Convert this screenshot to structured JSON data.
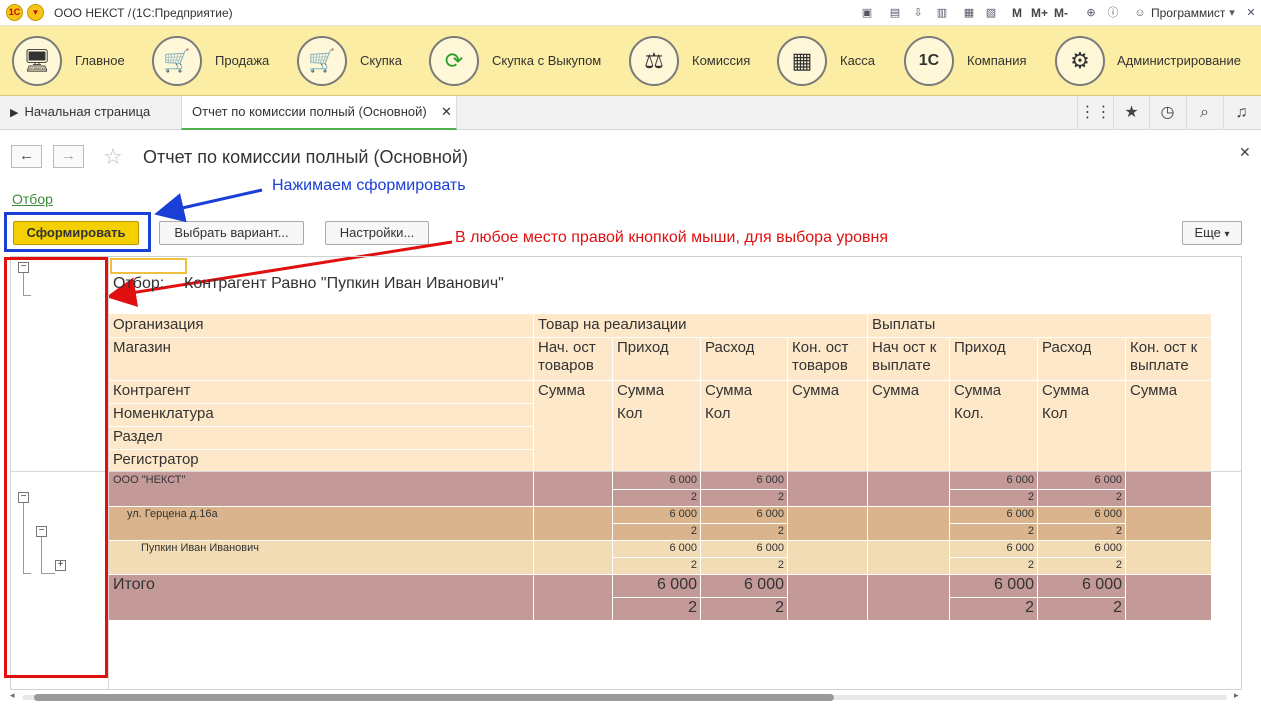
{
  "titlebar": {
    "app_name": "ООО НЕКСТ /",
    "platform": "(1С:Предприятие)",
    "m_buttons": [
      "M",
      "M+",
      "M-"
    ],
    "user": "Программист"
  },
  "sections": [
    {
      "label": "Главное",
      "icon": "computer-icon"
    },
    {
      "label": "Продажа",
      "icon": "cart-up-icon"
    },
    {
      "label": "Скупка",
      "icon": "cart-down-icon"
    },
    {
      "label": "Скупка с Выкупом",
      "icon": "refresh-icon"
    },
    {
      "label": "Комиссия",
      "icon": "scales-icon"
    },
    {
      "label": "Касса",
      "icon": "cash-register-icon"
    },
    {
      "label": "Компания",
      "icon": "1c-logo-icon"
    },
    {
      "label": "Администрирование",
      "icon": "gears-icon"
    }
  ],
  "tabs": {
    "home": "Начальная страница",
    "active": "Отчет по комиссии полный (Основной)"
  },
  "form": {
    "title": "Отчет по комиссии полный (Основной)",
    "otbor_link": "Отбор",
    "btn_generate": "Сформировать",
    "btn_variant": "Выбрать вариант...",
    "btn_settings": "Настройки...",
    "btn_more": "Еще"
  },
  "annotations": {
    "blue": "Нажимаем сформировать",
    "red": "В любое место правой кнопкой мыши, для выбора уровня"
  },
  "report": {
    "filter_label": "Отбор:",
    "filter_value": "Контрагент Равно \"Пупкин Иван Иванович\"",
    "header": {
      "row_fields": [
        "Организация",
        "Магазин",
        "Контрагент",
        "Номенклатура",
        "Раздел",
        "Регистратор"
      ],
      "group1": "Товар на реализации",
      "group2": "Выплаты",
      "g1_cols": [
        "Нач. ост товаров",
        "Приход",
        "Расход",
        "Кон. ост товаров"
      ],
      "g2_cols": [
        "Нач ост к выплате",
        "Приход",
        "Расход",
        "Кон. ост к выплате"
      ],
      "summa": "Сумма",
      "kol": "Кол",
      "kol_dot": "Кол."
    },
    "rows": [
      {
        "name": "ООО \"НЕКСТ\"",
        "prihod_sum": "6 000",
        "rashod_sum": "6 000",
        "prihod_kol": "2",
        "rashod_kol": "2",
        "v_prihod_sum": "6 000",
        "v_rashod_sum": "6 000",
        "v_prihod_kol": "2",
        "v_rashod_kol": "2"
      },
      {
        "name": "ул. Герцена д.16а",
        "prihod_sum": "6 000",
        "rashod_sum": "6 000",
        "prihod_kol": "2",
        "rashod_kol": "2",
        "v_prihod_sum": "6 000",
        "v_rashod_sum": "6 000",
        "v_prihod_kol": "2",
        "v_rashod_kol": "2"
      },
      {
        "name": "Пупкин Иван Иванович",
        "prihod_sum": "6 000",
        "rashod_sum": "6 000",
        "prihod_kol": "2",
        "rashod_kol": "2",
        "v_prihod_sum": "6 000",
        "v_rashod_sum": "6 000",
        "v_prihod_kol": "2",
        "v_rashod_kol": "2"
      }
    ],
    "total": {
      "name": "Итого",
      "prihod_sum": "6 000",
      "rashod_sum": "6 000",
      "prihod_kol": "2",
      "rashod_kol": "2",
      "v_prihod_sum": "6 000",
      "v_rashod_sum": "6 000",
      "v_prihod_kol": "2",
      "v_rashod_kol": "2"
    }
  },
  "colors": {
    "accent_yellow": "#f5d000",
    "sections_bg": "#fbeda3",
    "header_bg": "#fde8c9",
    "row_org": "#c49a98",
    "row_shop": "#d9b48c",
    "row_contr": "#f2dcb6",
    "annotation_blue": "#1a3fd6",
    "annotation_red": "#e01010"
  }
}
